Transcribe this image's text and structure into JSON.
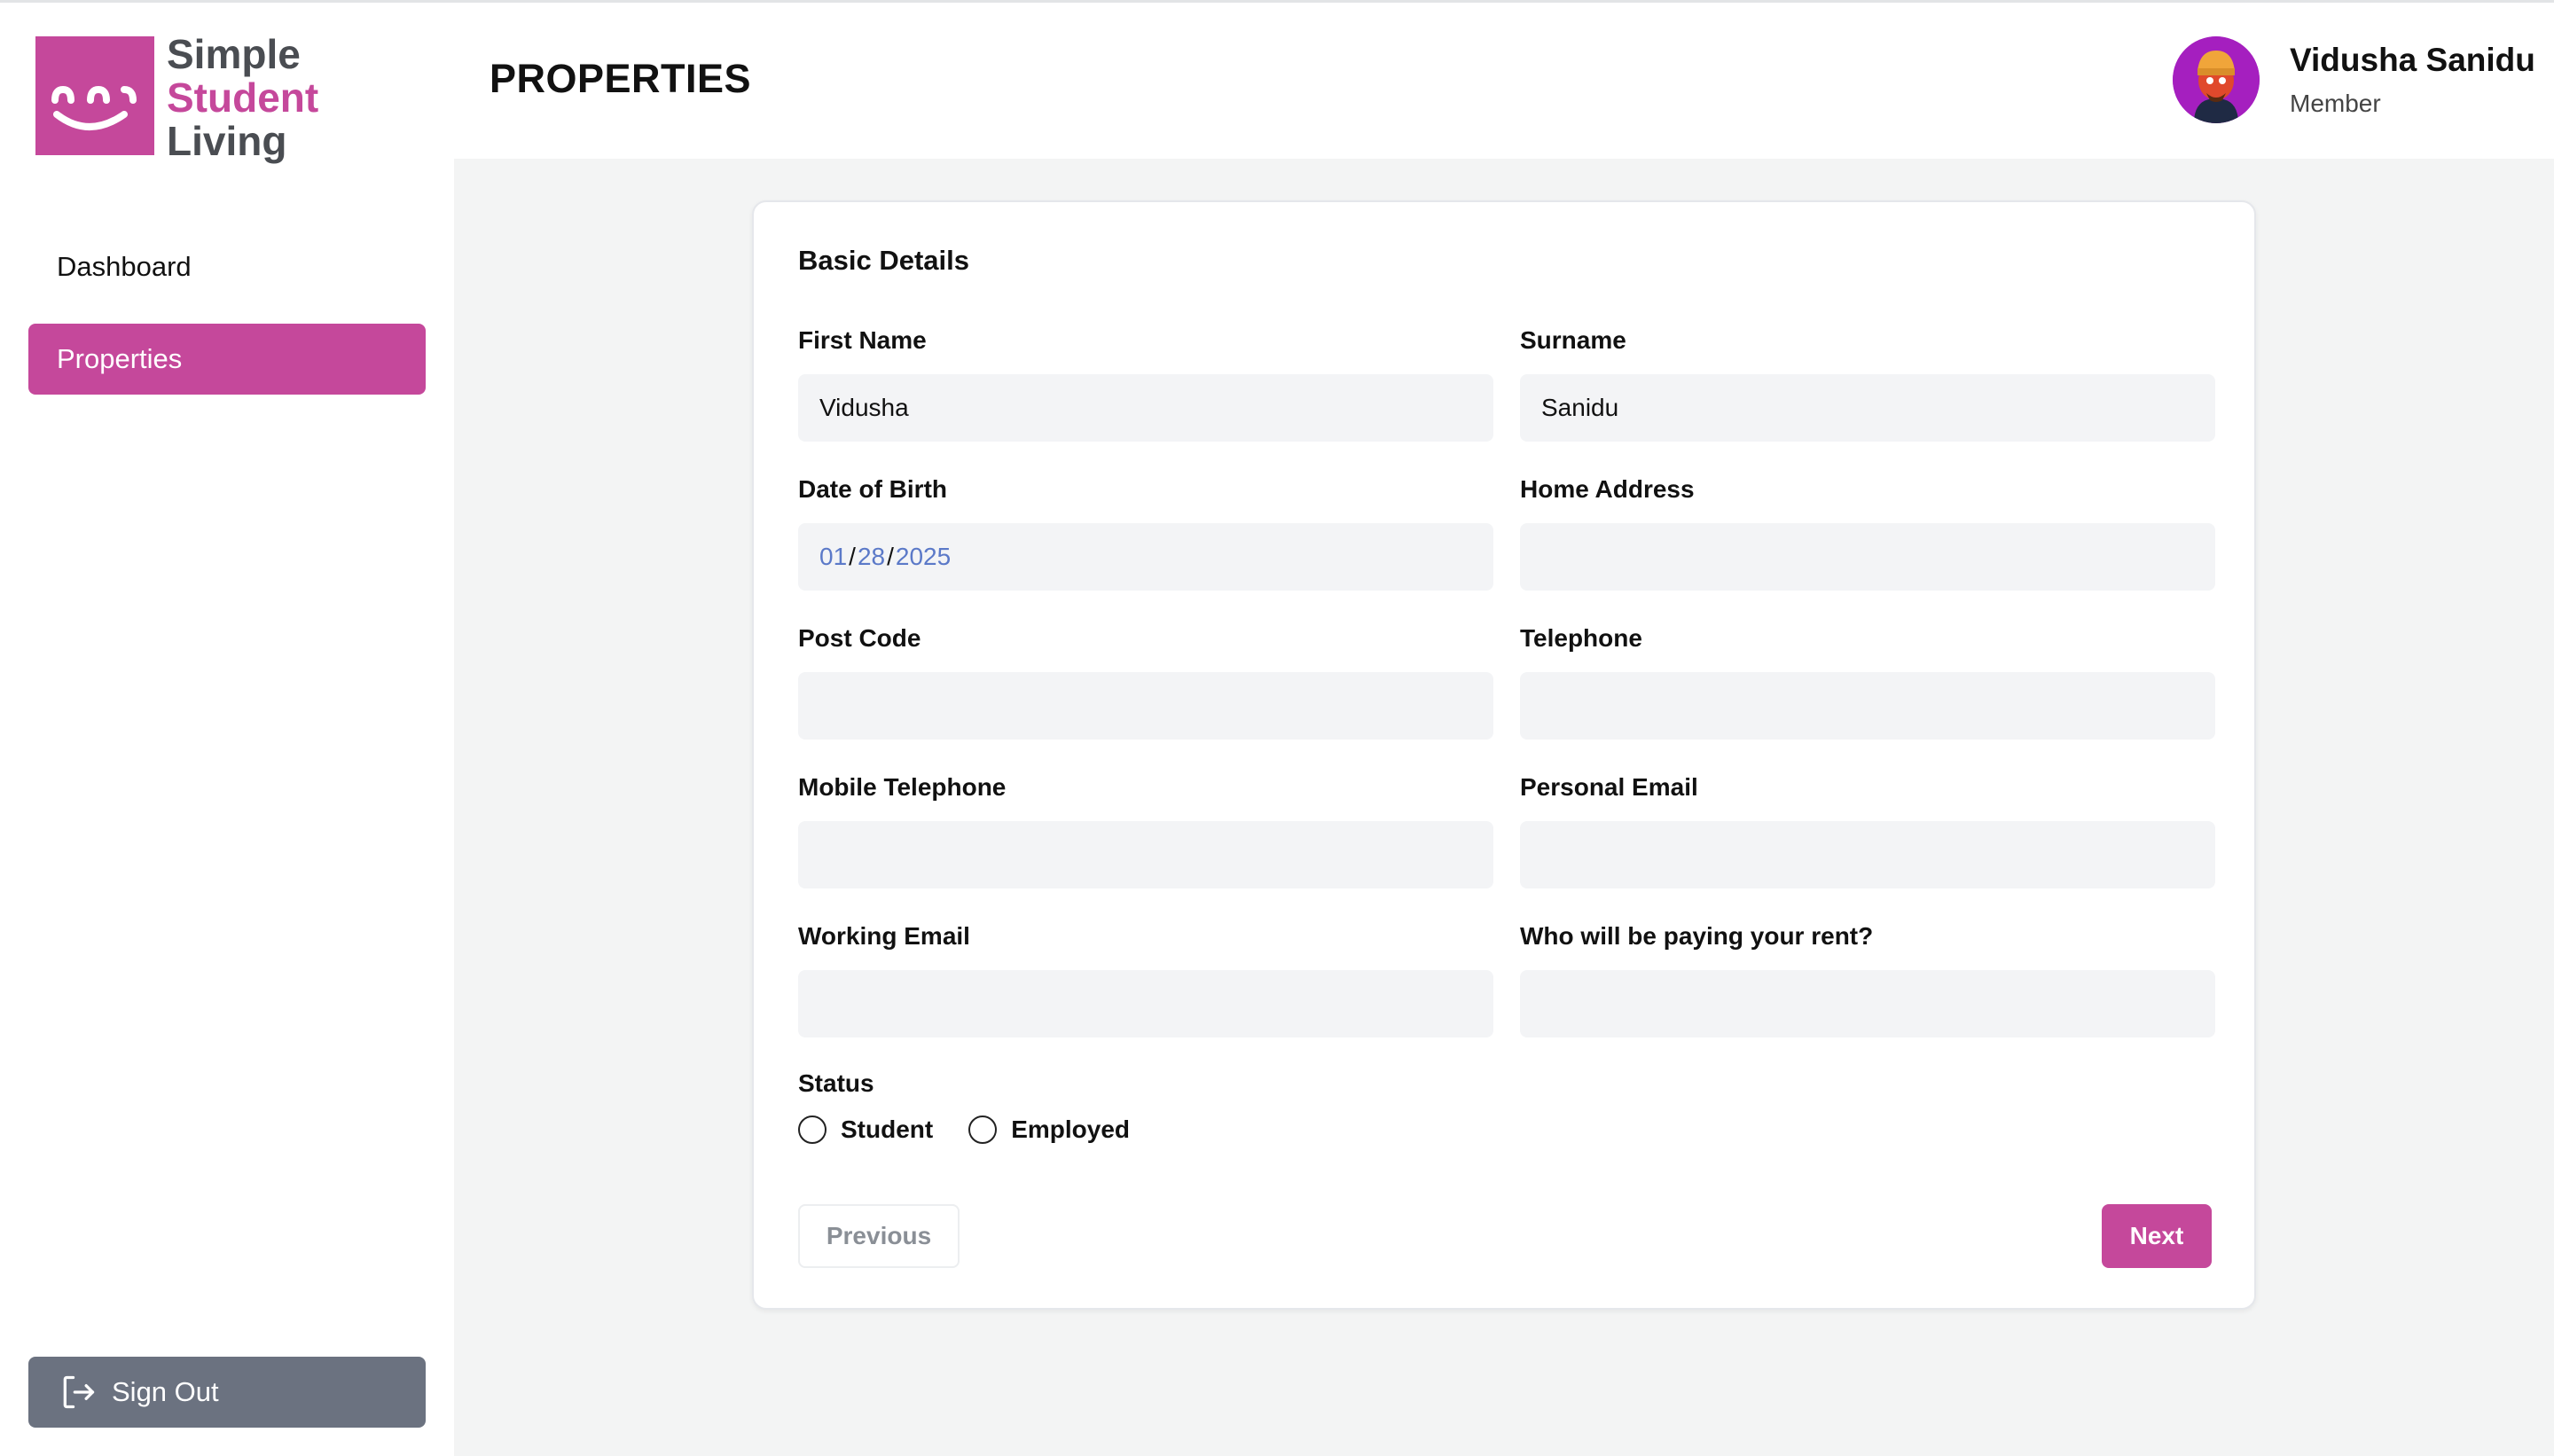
{
  "brand": {
    "line1": "Simple",
    "line2": "Student",
    "line3": "Living",
    "color": "#c5489b",
    "icon": "smile-logo-icon"
  },
  "sidebar": {
    "items": [
      {
        "label": "Dashboard",
        "active": false
      },
      {
        "label": "Properties",
        "active": true
      }
    ],
    "signout_label": "Sign Out",
    "signout_icon": "sign-out-icon"
  },
  "header": {
    "title": "PROPERTIES",
    "user": {
      "name": "Vidusha Sanidu",
      "role": "Member",
      "avatar_icon": "avatar-icon"
    }
  },
  "form": {
    "section_title": "Basic Details",
    "fields": {
      "first_name": {
        "label": "First Name",
        "value": "Vidusha"
      },
      "surname": {
        "label": "Surname",
        "value": "Sanidu"
      },
      "dob": {
        "label": "Date of Birth",
        "month": "01",
        "day": "28",
        "year": "2025"
      },
      "home_address": {
        "label": "Home Address",
        "value": ""
      },
      "post_code": {
        "label": "Post Code",
        "value": ""
      },
      "telephone": {
        "label": "Telephone",
        "value": ""
      },
      "mobile": {
        "label": "Mobile Telephone",
        "value": ""
      },
      "personal_email": {
        "label": "Personal Email",
        "value": ""
      },
      "working_email": {
        "label": "Working Email",
        "value": ""
      },
      "rent_payer": {
        "label": "Who will be paying your rent?",
        "value": ""
      }
    },
    "status": {
      "label": "Status",
      "options": [
        "Student",
        "Employed"
      ],
      "selected": null
    },
    "buttons": {
      "previous": "Previous",
      "next": "Next"
    }
  }
}
